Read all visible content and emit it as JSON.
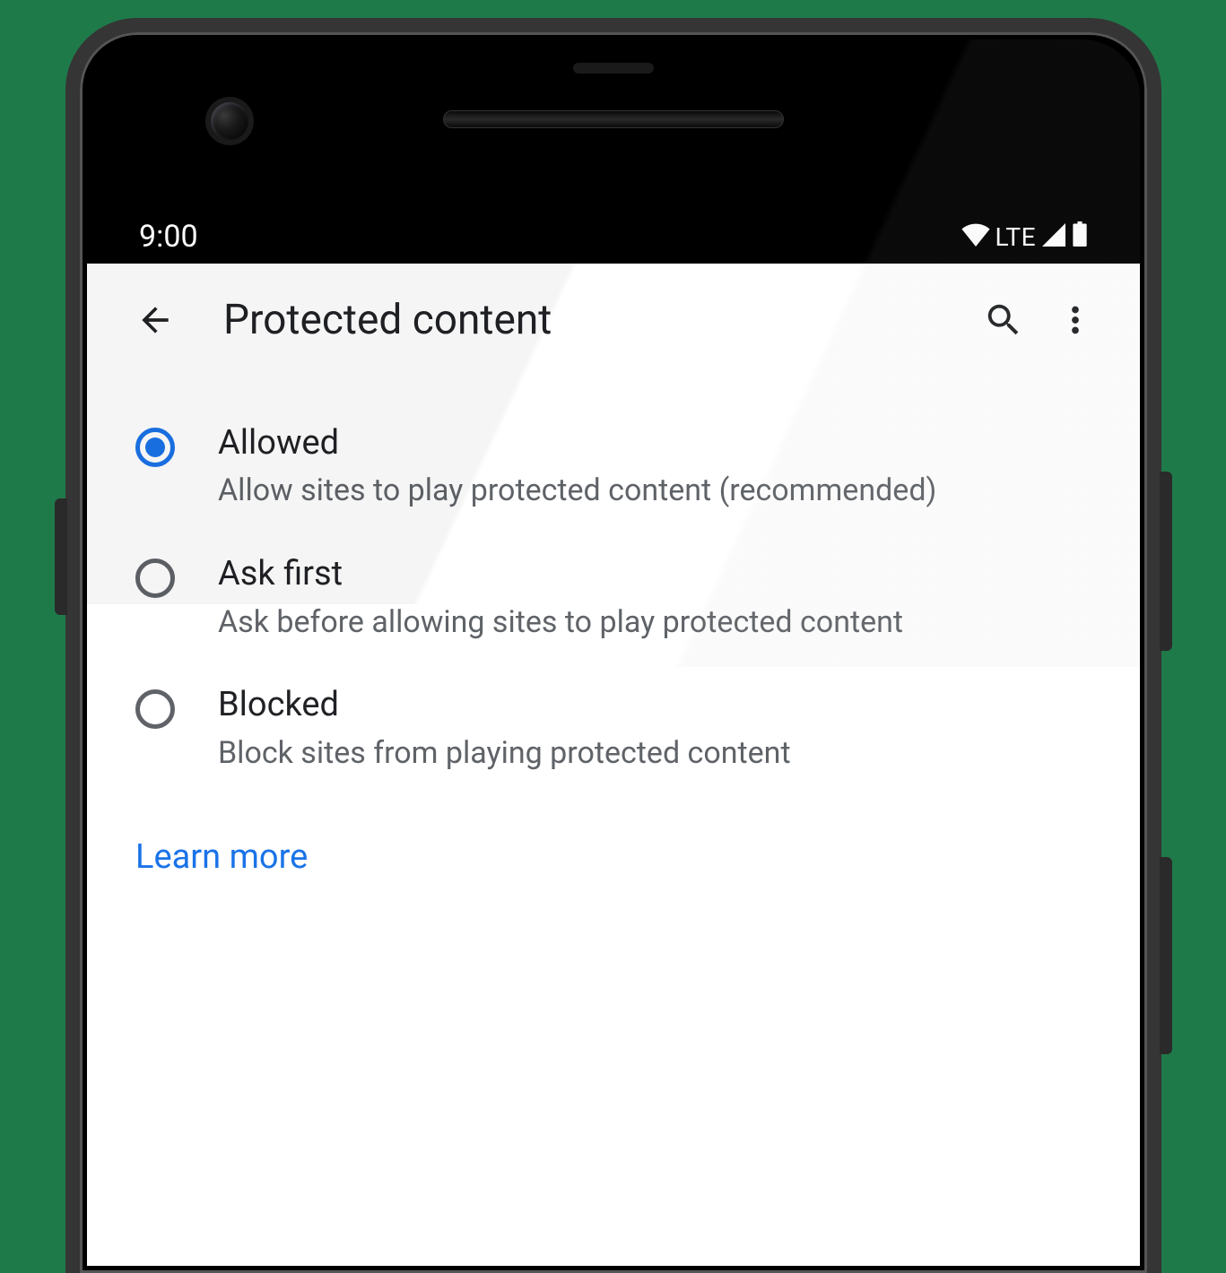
{
  "status_bar": {
    "time": "9:00",
    "network_label": "LTE"
  },
  "app_bar": {
    "title": "Protected content"
  },
  "options": [
    {
      "title": "Allowed",
      "description": "Allow sites to play protected content (recommended)",
      "selected": true
    },
    {
      "title": "Ask first",
      "description": "Ask before allowing sites to play protected content",
      "selected": false
    },
    {
      "title": "Blocked",
      "description": "Block sites from playing protected content",
      "selected": false
    }
  ],
  "footer": {
    "learn_more": "Learn more"
  },
  "colors": {
    "accent": "#1a73e8",
    "text_primary": "#202124",
    "text_secondary": "#5f6368"
  }
}
